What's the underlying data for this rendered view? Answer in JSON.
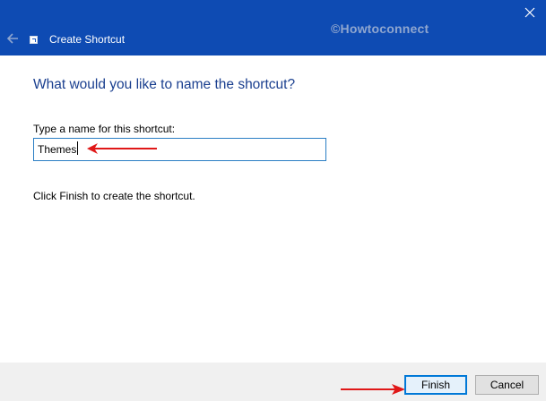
{
  "window": {
    "title": "Create Shortcut",
    "watermark": "©Howtoconnect"
  },
  "icons": {
    "back": "arrow-left-icon",
    "app": "shortcut-icon",
    "close": "close-icon"
  },
  "main": {
    "heading": "What would you like to name the shortcut?",
    "name_label": "Type a name for this shortcut:",
    "name_value": "Themes",
    "hint": "Click Finish to create the shortcut."
  },
  "footer": {
    "finish_label": "Finish",
    "cancel_label": "Cancel"
  },
  "colors": {
    "titlebar": "#0e4bb3",
    "heading": "#1a3f8f",
    "annotation_arrow": "#e01818",
    "focus_border": "#0078d7"
  }
}
